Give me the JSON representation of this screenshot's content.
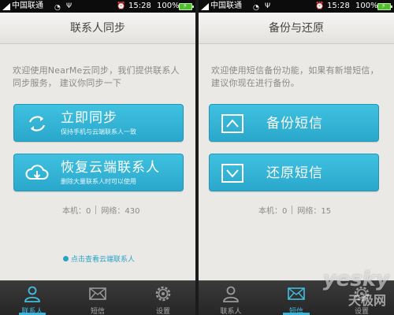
{
  "status_bar": {
    "carrier": "中国联通",
    "time": "15:28",
    "battery": "100%"
  },
  "left_screen": {
    "title": "联系人同步",
    "description": "欢迎使用NearMe云同步，我们提供联系人同步服务， 建议你同步一下",
    "sync_button": {
      "label": "立即同步",
      "sub": "保持手机与云端联系人一致"
    },
    "restore_button": {
      "label": "恢复云端联系人",
      "sub": "删除大量联系人时可以使用"
    },
    "local_label": "本机：0",
    "network_label": "网络：430",
    "view_link": "点击查看云端联系人",
    "tabs": [
      {
        "label": "联系人",
        "icon": "person-icon",
        "active": true
      },
      {
        "label": "短信",
        "icon": "envelope-icon",
        "active": false
      },
      {
        "label": "设置",
        "icon": "gear-icon",
        "active": false
      }
    ]
  },
  "right_screen": {
    "title": "备份与还原",
    "description": "欢迎使用短信备份功能，如果有新增短信，建议你现在进行备份。",
    "backup_button": {
      "label": "备份短信"
    },
    "restore_button": {
      "label": "还原短信"
    },
    "local_label": "本机：0",
    "network_label": "网络：15",
    "tabs": [
      {
        "label": "联系人",
        "icon": "person-icon",
        "active": false
      },
      {
        "label": "短信",
        "icon": "envelope-icon",
        "active": true
      },
      {
        "label": "设置",
        "icon": "gear-icon",
        "active": false
      }
    ]
  },
  "watermark": {
    "line1": "yesky",
    "line2": "天极网"
  },
  "colors": {
    "accent": "#2aa8cc",
    "background": "#ebe9e6",
    "tab_bar": "#262626",
    "active_tab": "#42bde0"
  }
}
